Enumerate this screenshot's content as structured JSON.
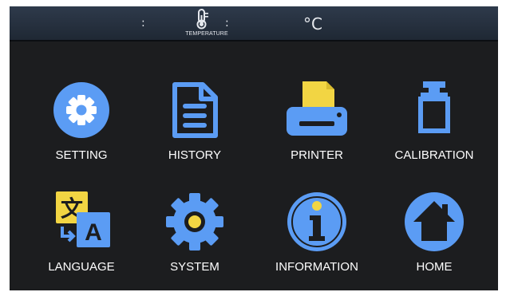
{
  "status_bar": {
    "separator_1": ":",
    "temperature_label": "TEMPERATURE",
    "separator_2": ":",
    "unit": "°C"
  },
  "menu": {
    "items": [
      {
        "id": "setting",
        "label": "SETTING",
        "icon": "gear-circle-icon"
      },
      {
        "id": "history",
        "label": "HISTORY",
        "icon": "document-icon"
      },
      {
        "id": "printer",
        "label": "PRINTER",
        "icon": "printer-icon"
      },
      {
        "id": "calibration",
        "label": "CALIBRATION",
        "icon": "weight-icon"
      },
      {
        "id": "language",
        "label": "LANGUAGE",
        "icon": "translate-icon"
      },
      {
        "id": "system",
        "label": "SYSTEM",
        "icon": "gear-icon"
      },
      {
        "id": "information",
        "label": "INFORMATION",
        "icon": "info-icon"
      },
      {
        "id": "home",
        "label": "HOME",
        "icon": "home-icon"
      }
    ]
  },
  "colors": {
    "icon_blue": "#5b9cf4",
    "accent_yellow": "#f2d543",
    "screen_background": "#1c1d1f",
    "status_bar": "#2a3544"
  }
}
